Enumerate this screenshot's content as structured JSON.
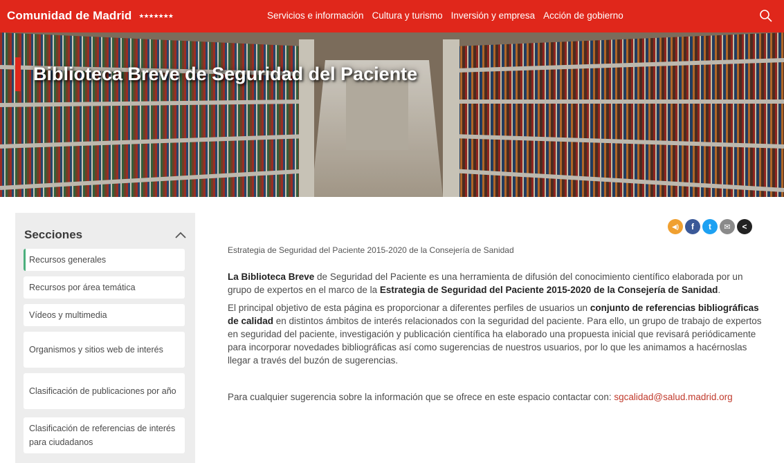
{
  "header": {
    "brand": "Comunidad de Madrid",
    "brand_stars": "★★★★★★★",
    "nav": [
      "Servicios e información",
      "Cultura y turismo",
      "Inversión y empresa",
      "Acción de gobierno"
    ]
  },
  "hero": {
    "title": "Biblioteca Breve de Seguridad del Paciente"
  },
  "sidebar": {
    "title": "Secciones",
    "items": [
      {
        "label": "Recursos generales"
      },
      {
        "label": "Recursos por área temática"
      },
      {
        "label": "Vídeos y multimedia"
      },
      {
        "label": "Organismos y sitios web de interés"
      },
      {
        "label": "Clasificación de publicaciones por año"
      },
      {
        "label": "Clasificación de referencias de interés para ciudadanos"
      }
    ]
  },
  "social": {
    "icons": [
      "audio-icon",
      "facebook-icon",
      "twitter-icon",
      "email-icon",
      "share-icon"
    ],
    "letters": [
      "◀)",
      "f",
      "t",
      "✉",
      "<"
    ],
    "colors": [
      "#f0a030",
      "#3b5998",
      "#1da1f2",
      "#8a8a8a",
      "#222222"
    ]
  },
  "main": {
    "subtitle": "Estrategia de Seguridad del Paciente 2015-2020 de la Consejería de Sanidad",
    "p1": {
      "bold1": "La Biblioteca Breve",
      "text1": " de Seguridad del Paciente es una herramienta de difusión del conocimiento científico elaborada por un grupo de expertos en el marco de la ",
      "bold2": "Estrategia de Seguridad del Paciente 2015-2020 de la Consejería de Sanidad",
      "text2": "."
    },
    "p2": {
      "text1": "El principal objetivo de esta página es proporcionar a diferentes perfiles de usuarios un ",
      "bold1": "conjunto de referencias bibliográficas de calidad",
      "text2": " en distintos ámbitos de interés relacionados con la seguridad del paciente. Para ello, un grupo de trabajo de expertos en seguridad del paciente, investigación y publicación científica ha elaborado una propuesta inicial que revisará periódicamente para incorporar novedades bibliográficas así como sugerencias de nuestros usuarios, por lo que les animamos a hacérnoslas llegar a través del buzón de sugerencias."
    },
    "contact": {
      "text": "Para cualquier sugerencia sobre la información que se ofrece en este espacio contactar con: ",
      "email": "sgcalidad@salud.madrid.org"
    }
  },
  "colors": {
    "brand_red": "#e0271b",
    "sidebar_bg": "#ededed",
    "active_accent": "#4caf7d"
  }
}
